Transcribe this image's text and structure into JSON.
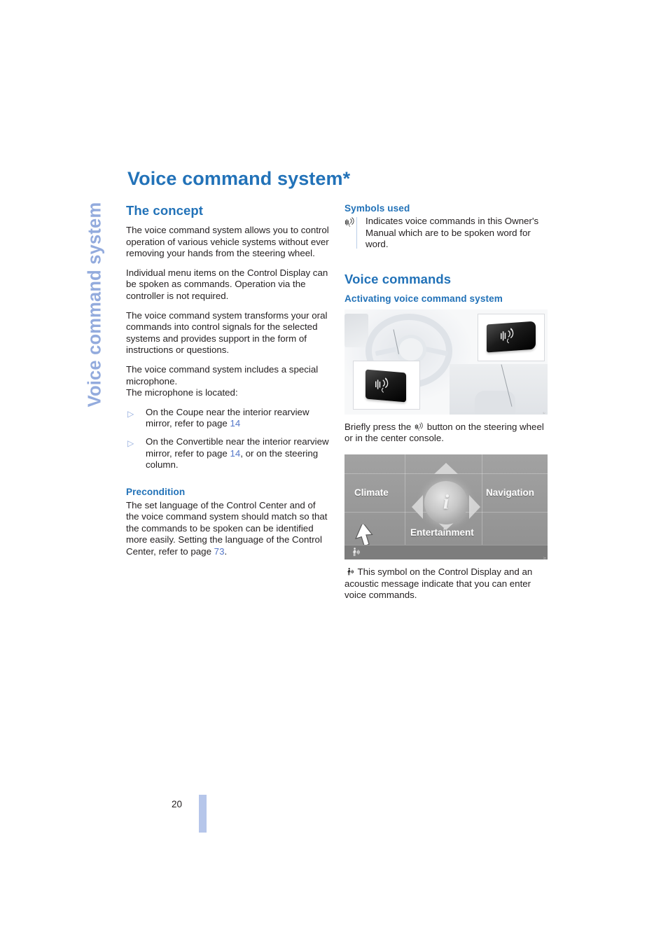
{
  "sidebar": {
    "chapter_label": "Voice command system"
  },
  "header": {
    "title": "Voice command system*"
  },
  "colors": {
    "heading_blue": "#2272b8",
    "sidebar_blue": "#93abdd",
    "page_ref_blue": "#5577c8",
    "bullet_blue": "#8fa8dc",
    "page_bar_blue": "#b6c6ea",
    "body_text": "#231f20"
  },
  "left_column": {
    "concept": {
      "heading": "The concept",
      "paragraphs": [
        "The voice command system allows you to control operation of various vehicle systems without ever removing your hands from the steering wheel.",
        "Individual menu items on the Control Display can be spoken as commands. Operation via the controller is not required.",
        "The voice command system transforms your oral commands into control signals for the selected systems and provides support in the form of instructions or questions."
      ],
      "mic_intro_line1": "The voice command system includes a special microphone.",
      "mic_intro_line2": "The microphone is located:",
      "bullets": [
        {
          "marker": "▷",
          "text_before": "On the Coupe near the interior rearview mirror, refer to page ",
          "page_ref": "14",
          "text_after": ""
        },
        {
          "marker": "▷",
          "text_before": "On the Convertible near the interior rearview mirror, refer to page ",
          "page_ref": "14",
          "text_after": ", or on the steering column."
        }
      ]
    },
    "precondition": {
      "heading": "Precondition",
      "text_before": "The set language of the Control Center and of the voice command system should match so that the commands to be spoken can be identified more easily. Setting the language of the Control Center, refer to page ",
      "page_ref": "73",
      "text_after": "."
    }
  },
  "right_column": {
    "symbols_used": {
      "heading": "Symbols used",
      "icon": "voice-command-icon",
      "text": "Indicates voice commands in this Owner's Manual which are to be spoken word for word."
    },
    "voice_commands": {
      "heading": "Voice commands",
      "activating": {
        "heading": "Activating voice command system",
        "figure_steering": {
          "name": "steering-wheel-and-console-button-figure",
          "credit": "wap-steering-wheel-console",
          "inset_top_right": "voice-command-button-console",
          "inset_bottom_left": "voice-command-button-steering-wheel"
        },
        "caption_before": "Briefly press the ",
        "caption_icon": "voice-command-icon",
        "caption_after": " button on the steering wheel or in the center console.",
        "figure_display": {
          "name": "control-display-figure",
          "credit": "bmw-control-display",
          "menu_items": [
            "Climate",
            "Navigation",
            "Entertainment"
          ],
          "center_glyph": "i",
          "status_icon": "voice-active-icon",
          "pointer": "white-cursor-arrow"
        },
        "note_icon": "voice-active-icon",
        "note_text": "This symbol on the Control Display and an acoustic message indicate that you can enter voice commands."
      }
    }
  },
  "footer": {
    "page_number": "20"
  }
}
